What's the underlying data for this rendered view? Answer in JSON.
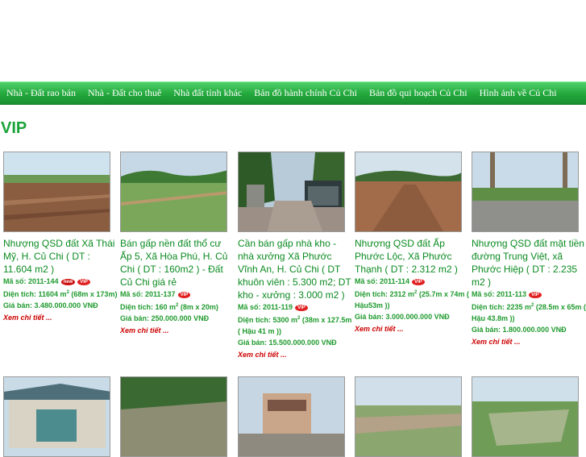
{
  "nav": {
    "items": [
      "Nhà - Đất rao bán",
      "Nhà - Đất cho thuê",
      "Nhà đất tỉnh khác",
      "Bản đồ hành chính Củ Chi",
      "Bản đồ qui hoạch Củ Chi",
      "Hình ảnh về Củ Chi"
    ]
  },
  "section_title": "VIP",
  "labels": {
    "code": "Mã số: ",
    "area": "Diện tích: ",
    "price": "Giá bán: ",
    "more": "Xem chi tiết ...",
    "vip_badge": "VIP",
    "new_badge": "new"
  },
  "listings": [
    {
      "title": "Nhượng QSD đất Xã Thái Mỹ, H. Củ Chi ( DT : 11.604 m2 )",
      "code": "2011-144",
      "area": "11604 m",
      "area_detail": " (68m x 173m)",
      "price": "3.480.000.000 VNĐ",
      "is_new": true
    },
    {
      "title": "Bán gấp nền đất thổ cư Ấp 5, Xã Hòa Phú, H. Củ Chi ( DT : 160m2 ) - Đất Củ Chi giá rẻ",
      "code": "2011-137",
      "area": "160 m",
      "area_detail": " (8m x 20m)",
      "price": "250.000.000 VNĐ",
      "is_new": false
    },
    {
      "title": "Cần bán gấp nhà kho - nhà xưởng Xã Phước Vĩnh An, H. Củ Chi ( DT khuôn viên : 5.300 m2; DT kho - xưởng : 3.000 m2 )",
      "code": "2011-119",
      "area": "5300 m",
      "area_detail": " (38m x 127.5m ( Hậu 41 m ))",
      "price": "15.500.000.000 VNĐ",
      "is_new": false
    },
    {
      "title": "Nhượng QSD đất Ấp Phước Lộc, Xã Phước Thạnh ( DT : 2.312 m2 )",
      "code": "2011-114",
      "area": "2312 m",
      "area_detail": " (25.7m x 74m ( Hậu53m ))",
      "price": "3.000.000.000 VNĐ",
      "is_new": false
    },
    {
      "title": "Nhượng QSD đất mặt tiền đường Trung Việt, xã Phước Hiệp ( DT : 2.235 m2 )",
      "code": "2011-113",
      "area": "2235 m",
      "area_detail": " (28.5m x 65m ( Hậu 43.8m ))",
      "price": "1.800.000.000 VNĐ",
      "is_new": false
    }
  ]
}
